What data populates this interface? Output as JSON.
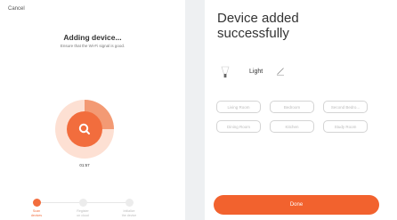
{
  "adding_screen": {
    "cancel_label": "Cancel",
    "title": "Adding device...",
    "subtitle": "Ensure that the Wi-Fi signal is good.",
    "progress_text": "01:57",
    "progress_fraction": 0.25,
    "steps": [
      {
        "label_line1": "Scan",
        "label_line2": "devices",
        "state": "active"
      },
      {
        "label_line1": "Register",
        "label_line2": "on cloud",
        "state": "pending"
      },
      {
        "label_line1": "Initialize",
        "label_line2": "the device",
        "state": "pending"
      }
    ],
    "accent_color": "#f26d3d"
  },
  "success_screen": {
    "title_line1": "Device added",
    "title_line2": "successfully",
    "device_name": "Light",
    "device_icon": "bulb-icon",
    "edit_icon": "pencil-icon",
    "rooms": [
      "Living Room",
      "Bedroom",
      "Second Bedro...",
      "Dining Room",
      "Kitchen",
      "Study Room"
    ],
    "done_label": "Done",
    "accent_color": "#f2622e"
  }
}
